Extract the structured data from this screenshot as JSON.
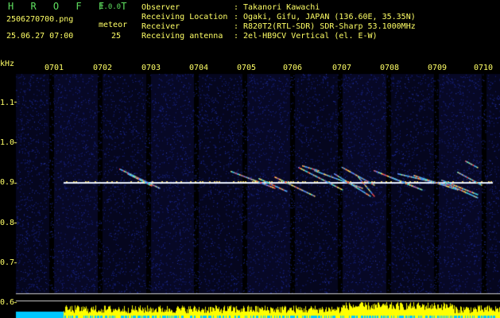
{
  "app": {
    "name": "H R O F F T",
    "version": "1.0.0"
  },
  "capture": {
    "filename": "2506270700.png",
    "datetime": "25.06.27 07:00",
    "meteor_label": "meteor",
    "meteor_count": "25"
  },
  "info": [
    {
      "key": "Observer",
      "sep": ":",
      "value": "Takanori Kawachi"
    },
    {
      "key": "Receiving Location",
      "sep": ":",
      "value": "Ogaki, Gifu, JAPAN (136.60E, 35.35N)"
    },
    {
      "key": "Receiver",
      "sep": ":",
      "value": "R820T2(RTL-SDR) SDR-Sharp 53.1000MHz"
    },
    {
      "key": "Receiving antenna",
      "sep": ":",
      "value": "2el-HB9CV Vertical (el. E-W)"
    }
  ],
  "axis": {
    "unit": "kHz",
    "y_ticks": [
      "1.1",
      "1.0",
      "0.9",
      "0.8",
      "0.7",
      "0.6"
    ],
    "x_ticks": [
      "0701",
      "0702",
      "0703",
      "0704",
      "0705",
      "0706",
      "0707",
      "0708",
      "0709",
      "0710"
    ]
  },
  "colors": {
    "header_text": "#ffff66",
    "logo": "#5fe05f",
    "background": "#000000",
    "noise": "#1c2a9a",
    "carrier": "#e8f0ff",
    "level_bar": "#ffff00",
    "level_low": "#00c8ff"
  }
}
